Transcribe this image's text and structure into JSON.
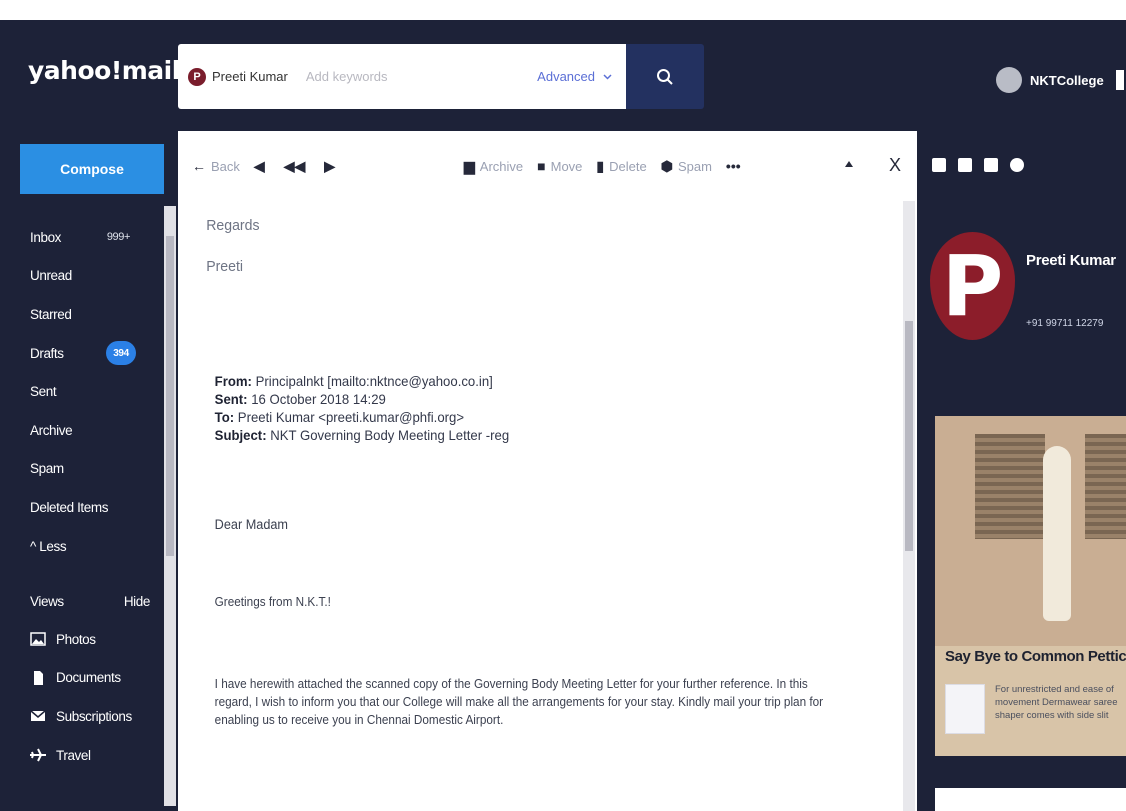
{
  "header": {
    "logo": "yahoo!mail",
    "search_chip_initial": "P",
    "search_chip_name": "Preeti Kumar",
    "search_placeholder": "Add keywords",
    "advanced_label": "Advanced",
    "user_name": "NKTCollege"
  },
  "sidebar": {
    "compose_label": "Compose",
    "items": [
      {
        "label": "Inbox",
        "count": "999+"
      },
      {
        "label": "Unread"
      },
      {
        "label": "Starred"
      },
      {
        "label": "Drafts",
        "badge": "394"
      },
      {
        "label": "Sent"
      },
      {
        "label": "Archive"
      },
      {
        "label": "Spam"
      },
      {
        "label": "Deleted Items"
      },
      {
        "label": "^ Less"
      }
    ],
    "views_label": "Views",
    "views_hide": "Hide",
    "views": [
      {
        "label": "Photos"
      },
      {
        "label": "Documents"
      },
      {
        "label": "Subscriptions"
      },
      {
        "label": "Travel"
      }
    ]
  },
  "toolbar": {
    "back_label": "Back",
    "archive_label": "Archive",
    "move_label": "Move",
    "delete_label": "Delete",
    "spam_label": "Spam",
    "more_label": "•••",
    "close_label": "X"
  },
  "message": {
    "regards": "Regards",
    "signature": "Preeti",
    "from_label": "From:",
    "from_value": "Principalnkt [mailto:nktnce@yahoo.co.in]",
    "sent_label": "Sent:",
    "sent_value": "16 October 2018 14:29",
    "to_label": "To:",
    "to_value": "Preeti Kumar <preeti.kumar@phfi.org>",
    "subject_label": "Subject:",
    "subject_value": "NKT Governing Body Meeting Letter -reg",
    "salutation": "Dear Madam",
    "greeting": "Greetings from N.K.T.!",
    "body": "I have herewith attached the scanned copy of the Governing Body Meeting Letter for your further reference. In this regard, I wish to inform you that our College will make all the arrangements for your stay. Kindly mail your trip plan for enabling us to receive you in Chennai Domestic Airport."
  },
  "contact": {
    "initial": "P",
    "name": "Preeti Kumar",
    "phone": "+91 99711 12279"
  },
  "ad": {
    "title": "Say Bye to Common Petticoat",
    "text": "For unrestricted and ease of movement Dermawear saree shaper comes with side slit"
  },
  "colors": {
    "app_bg": "#1d2238",
    "compose": "#2b8fe3",
    "badge": "#2b80e6",
    "search_button": "#233160",
    "avatar": "#8c1d2a"
  }
}
